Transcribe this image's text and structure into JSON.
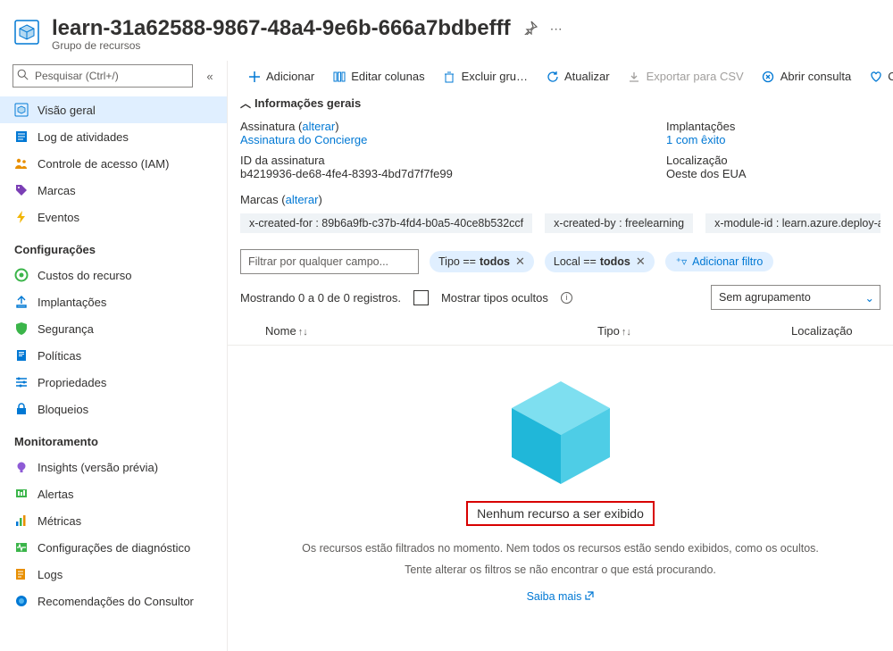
{
  "header": {
    "title": "learn-31a62588-9867-48a4-9e6b-666a7bdbefff",
    "subtitle": "Grupo de recursos"
  },
  "search": {
    "placeholder": "Pesquisar (Ctrl+/)"
  },
  "sidebar": {
    "items": {
      "overview": "Visão geral",
      "activitylog": "Log de atividades",
      "iam": "Controle de acesso (IAM)",
      "tags": "Marcas",
      "events": "Eventos"
    },
    "section_settings": "Configurações",
    "settings": {
      "cost": "Custos do recurso",
      "deployments": "Implantações",
      "security": "Segurança",
      "policies": "Políticas",
      "properties": "Propriedades",
      "locks": "Bloqueios"
    },
    "section_monitoring": "Monitoramento",
    "monitoring": {
      "insights": "Insights (versão prévia)",
      "alerts": "Alertas",
      "metrics": "Métricas",
      "diag": "Configurações de diagnóstico",
      "logs": "Logs",
      "advisor": "Recomendações do Consultor"
    }
  },
  "toolbar": {
    "add": "Adicionar",
    "editcols": "Editar colunas",
    "delete": "Excluir gru…",
    "refresh": "Atualizar",
    "export": "Exportar para CSV",
    "query": "Abrir consulta",
    "comment": "Coment…"
  },
  "essentials": {
    "header": "Informações gerais",
    "sub_label": "Assinatura",
    "sub_change": "alterar",
    "sub_value": "Assinatura do Concierge",
    "subid_label": "ID da assinatura",
    "subid_value": "b4219936-de68-4fe4-8393-4bd7d7f7fe99",
    "tags_label": "Marcas",
    "tags_change": "alterar",
    "dep_label": "Implantações",
    "dep_value": "1 com êxito",
    "loc_label": "Localização",
    "loc_value": "Oeste dos EUA",
    "tags": [
      "x-created-for : 89b6a9fb-c37b-4fd4-b0a5-40ce8b532ccf",
      "x-created-by : freelearning",
      "x-module-id : learn.azure.deploy-az"
    ]
  },
  "filters": {
    "placeholder": "Filtrar por qualquer campo...",
    "type_prefix": "Tipo == ",
    "type_value": "todos",
    "loc_prefix": "Local == ",
    "loc_value": "todos",
    "add": "Adicionar filtro"
  },
  "results": {
    "text": "Mostrando 0 a 0 de 0 registros.",
    "hidden": "Mostrar tipos ocultos",
    "grouping": "Sem agrupamento"
  },
  "grid": {
    "name": "Nome",
    "type": "Tipo",
    "loc": "Localização"
  },
  "empty": {
    "title": "Nenhum recurso a ser exibido",
    "line1": "Os recursos estão filtrados no momento. Nem todos os recursos estão sendo exibidos, como os ocultos.",
    "line2": "Tente alterar os filtros se não encontrar o que está procurando.",
    "learn": "Saiba mais"
  }
}
